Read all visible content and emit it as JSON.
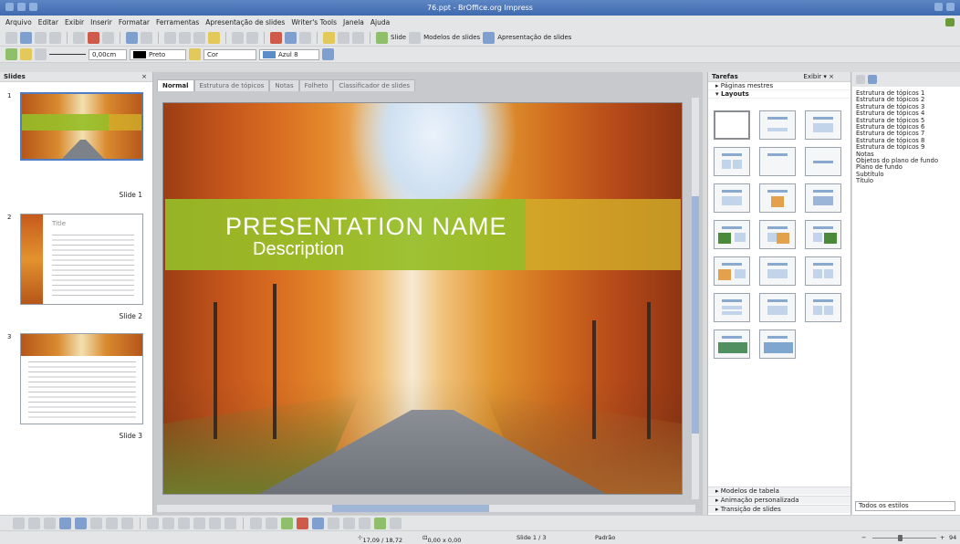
{
  "window": {
    "title": "76.ppt - BrOffice.org Impress"
  },
  "menu": [
    "Arquivo",
    "Editar",
    "Exibir",
    "Inserir",
    "Formatar",
    "Ferramentas",
    "Apresentação de slides",
    "Writer's Tools",
    "Janela",
    "Ajuda"
  ],
  "toolbar": {
    "slide_label": "Slide",
    "templates_label": "Modelos de slides",
    "slideshow_label": "Apresentação de slides"
  },
  "format_bar": {
    "line_width": "0,00cm",
    "line_color": "Preto",
    "fill_type": "Cor",
    "fill_color": "Azul 8"
  },
  "slides_pane": {
    "title": "Slides",
    "close": "×",
    "slides": [
      {
        "num": "1",
        "label": "Slide 1"
      },
      {
        "num": "2",
        "label": "Slide 2",
        "thumb_title": "Title"
      },
      {
        "num": "3",
        "label": "Slide 3"
      }
    ]
  },
  "view_tabs": [
    "Normal",
    "Estrutura de tópicos",
    "Notas",
    "Folheto",
    "Classificador de slides"
  ],
  "slide": {
    "title": "PRESENTATION  NAME",
    "subtitle": "Description"
  },
  "tasks_pane": {
    "title": "Tarefas",
    "view_menu": "Exibir  ▾  ×",
    "sections": [
      "Páginas mestres",
      "Layouts"
    ],
    "footer_sections": [
      "Modelos de tabela",
      "Animação personalizada",
      "Transição de slides"
    ]
  },
  "styles_pane": {
    "items": [
      "Estrutura de tópicos 1",
      "Estrutura de tópicos 2",
      "Estrutura de tópicos 3",
      "Estrutura de tópicos 4",
      "Estrutura de tópicos 5",
      "Estrutura de tópicos 6",
      "Estrutura de tópicos 7",
      "Estrutura de tópicos 8",
      "Estrutura de tópicos 9",
      "Notas",
      "Objetos do plano de fundo",
      "Plano de fundo",
      "Subtítulo",
      "Título"
    ],
    "filter": "Todos os estilos"
  },
  "status": {
    "position": "17,09 / 18,72",
    "size": "0,00 x 0,00",
    "slide": "Slide 1 / 3",
    "layout": "Padrão",
    "zoom": "94"
  }
}
